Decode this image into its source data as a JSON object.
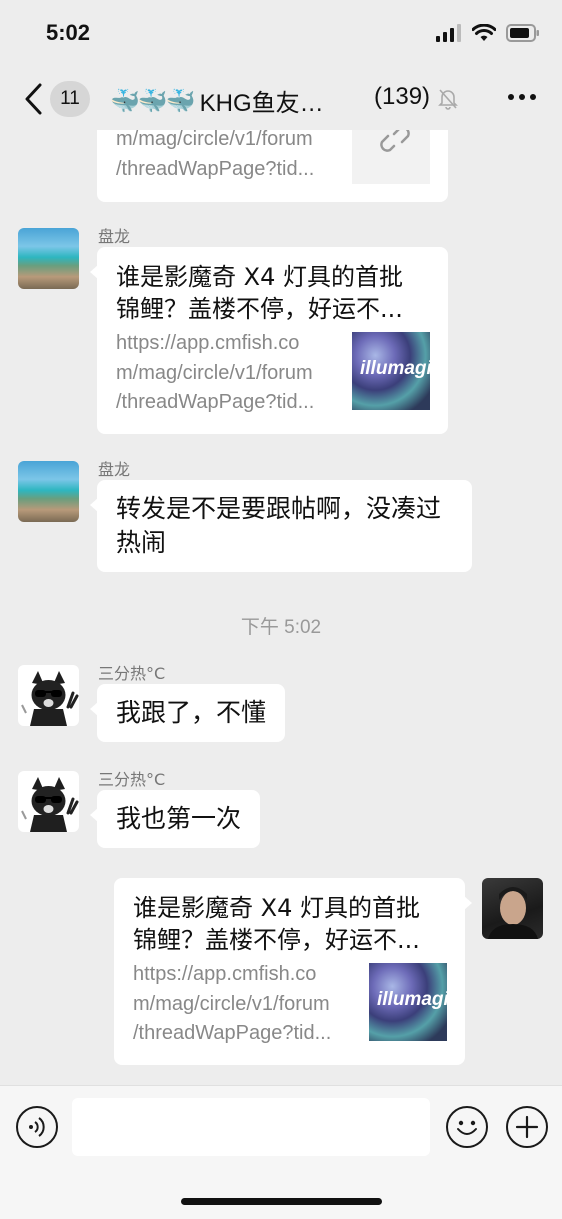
{
  "status_bar": {
    "time": "5:02"
  },
  "nav": {
    "back_count": "11",
    "title_emoji": "🐳🐳🐳",
    "title_text": "KHG鱼友…",
    "member_count": "(139)"
  },
  "messages": {
    "m0": {
      "url": "m/mag/circle/v1/forum\n/threadWapPage?tid..."
    },
    "m1": {
      "sender": "盘龙",
      "title": "谁是影魔奇 X4 灯具的首批锦鲤？盖楼不停，好运不...",
      "url": "https://app.cmfish.co\nm/mag/circle/v1/forum\n/threadWapPage?tid...",
      "thumb_text": "illumagic"
    },
    "m2": {
      "sender": "盘龙",
      "text": "转发是不是要跟帖啊，没凑过热闹"
    },
    "timestamp": "下午 5:02",
    "m3": {
      "sender": "三分热°C",
      "text": "我跟了，不懂"
    },
    "m4": {
      "sender": "三分热°C",
      "text": "我也第一次"
    },
    "m5": {
      "title": "谁是影魔奇 X4 灯具的首批锦鲤？盖楼不停，好运不...",
      "url": "https://app.cmfish.co\nm/mag/circle/v1/forum\n/threadWapPage?tid...",
      "thumb_text": "illumagic"
    }
  },
  "input": {
    "placeholder": ""
  },
  "icons": {
    "back": "chevron-left-icon",
    "mute": "bell-muted-icon",
    "more": "more-horizontal-icon",
    "voice": "voice-icon",
    "emoji": "emoji-icon",
    "plus": "plus-icon",
    "link": "link-icon"
  },
  "colors": {
    "background": "#ededed",
    "bubble": "#ffffff",
    "muted_text": "#888888"
  }
}
